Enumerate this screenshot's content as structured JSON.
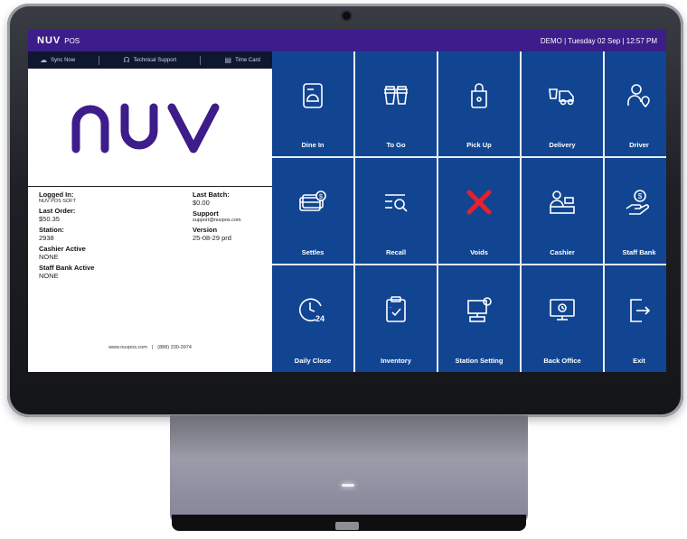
{
  "header": {
    "brand": "NUV",
    "product": "POS",
    "status": "DEMO | Tuesday 02 Sep  | 12:57 PM"
  },
  "toolbar": {
    "items": [
      {
        "label": "Sync Now",
        "icon": "sync-icon"
      },
      {
        "label": "Technical Support",
        "icon": "headset-icon"
      },
      {
        "label": "Time Card",
        "icon": "time-card-icon"
      }
    ]
  },
  "logo": {
    "text": "nuv",
    "color": "#3c1d8a"
  },
  "info": {
    "logged_in_label": "Logged In:",
    "logged_in_value": "NUV POS SOFT",
    "last_order_label": "Last Order:",
    "last_order_value": "$50.35",
    "station_label": "Station:",
    "station_value": "2938",
    "cashier_label": "Cashier Active",
    "cashier_value": "NONE",
    "staff_bank_label": "Staff Bank Active",
    "staff_bank_value": "NONE",
    "last_batch_label": "Last Batch:",
    "last_batch_value": "$0.00",
    "support_label": "Support",
    "support_value": "support@nuvpos.com",
    "version_label": "Version",
    "version_value": "25-08-29 prd"
  },
  "footer": {
    "website": "www.nuvpos.com",
    "separator": "|",
    "phone": "(888) 330-3974"
  },
  "tiles": [
    {
      "label": "Dine In",
      "icon": "dine-in-icon"
    },
    {
      "label": "To Go",
      "icon": "to-go-icon"
    },
    {
      "label": "Pick Up",
      "icon": "pick-up-icon"
    },
    {
      "label": "Delivery",
      "icon": "delivery-icon"
    },
    {
      "label": "Driver",
      "icon": "driver-icon"
    },
    {
      "label": "Settles",
      "icon": "settles-icon"
    },
    {
      "label": "Recall",
      "icon": "recall-icon"
    },
    {
      "label": "Voids",
      "icon": "voids-icon"
    },
    {
      "label": "Cashier",
      "icon": "cashier-icon"
    },
    {
      "label": "Staff Bank",
      "icon": "staff-bank-icon"
    },
    {
      "label": "Daily Close",
      "icon": "daily-close-icon"
    },
    {
      "label": "Inventory",
      "icon": "inventory-icon"
    },
    {
      "label": "Station Setting",
      "icon": "station-setting-icon"
    },
    {
      "label": "Back Office",
      "icon": "back-office-icon"
    },
    {
      "label": "Exit",
      "icon": "exit-icon"
    }
  ],
  "colors": {
    "header_bg": "#3c1d8a",
    "tile_bg": "#114592",
    "toolbar_bg": "#0e1630",
    "void_red": "#e8202a"
  }
}
